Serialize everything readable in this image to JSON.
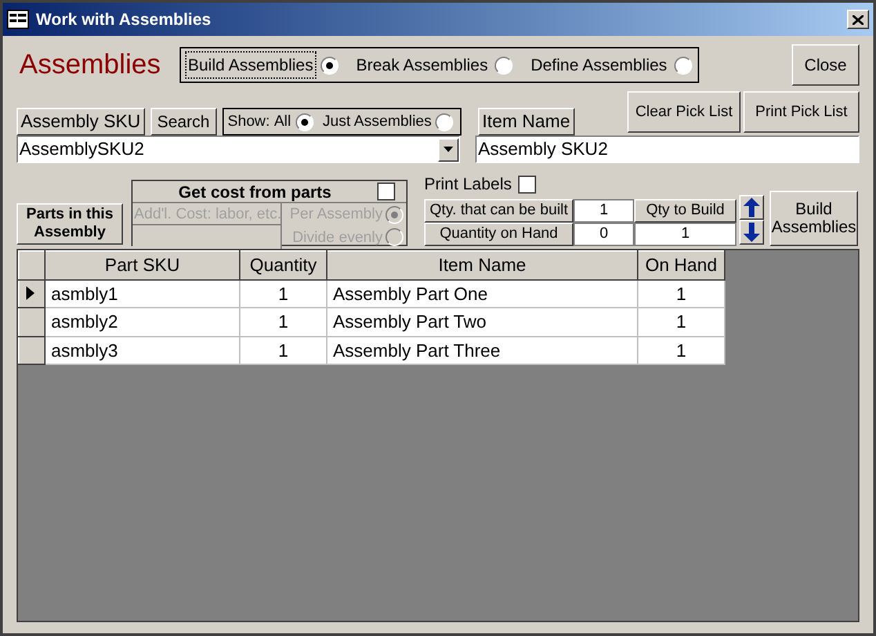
{
  "window": {
    "title": "Work with Assemblies"
  },
  "heading": "Assemblies",
  "modes": [
    {
      "label": "Build Assemblies",
      "selected": true
    },
    {
      "label": "Break Assemblies",
      "selected": false
    },
    {
      "label": "Define Assemblies",
      "selected": false
    }
  ],
  "close_button": "Close",
  "clear_pick_list_button": "Clear Pick List",
  "print_pick_list_button": "Print Pick List",
  "assembly_sku": {
    "label": "Assembly SKU",
    "value": "AssemblySKU2"
  },
  "search_button": "Search",
  "show": {
    "label": "Show:",
    "options": [
      {
        "label": "All",
        "selected": true
      },
      {
        "label": "Just Assemblies",
        "selected": false
      }
    ]
  },
  "item_name": {
    "label": "Item Name",
    "value": "Assembly SKU2"
  },
  "parts_label": "Parts in this Assembly",
  "get_cost": {
    "title": "Get cost from parts",
    "checked": false,
    "disabled": true,
    "addl_cost_label": "Add'l. Cost: labor, etc.",
    "options": [
      {
        "label": "Per Assembly",
        "selected": true
      },
      {
        "label": "Divide evenly",
        "selected": false
      }
    ]
  },
  "print_labels": {
    "label": "Print Labels",
    "checked": false
  },
  "qty": {
    "can_be_built_label": "Qty. that can be built",
    "can_be_built": "1",
    "to_build_label": "Qty to Build",
    "on_hand_label": "Quantity on Hand",
    "on_hand": "0",
    "to_build": "1"
  },
  "build_button": "Build Assemblies",
  "table": {
    "columns": [
      "Part SKU",
      "Quantity",
      "Item Name",
      "On Hand"
    ],
    "rows": [
      {
        "current": true,
        "cells": [
          "asmbly1",
          "1",
          "Assembly Part One",
          "1"
        ]
      },
      {
        "current": false,
        "cells": [
          "asmbly2",
          "1",
          "Assembly Part Two",
          "1"
        ]
      },
      {
        "current": false,
        "cells": [
          "asmbly3",
          "1",
          "Assembly Part Three",
          "1"
        ]
      }
    ]
  }
}
